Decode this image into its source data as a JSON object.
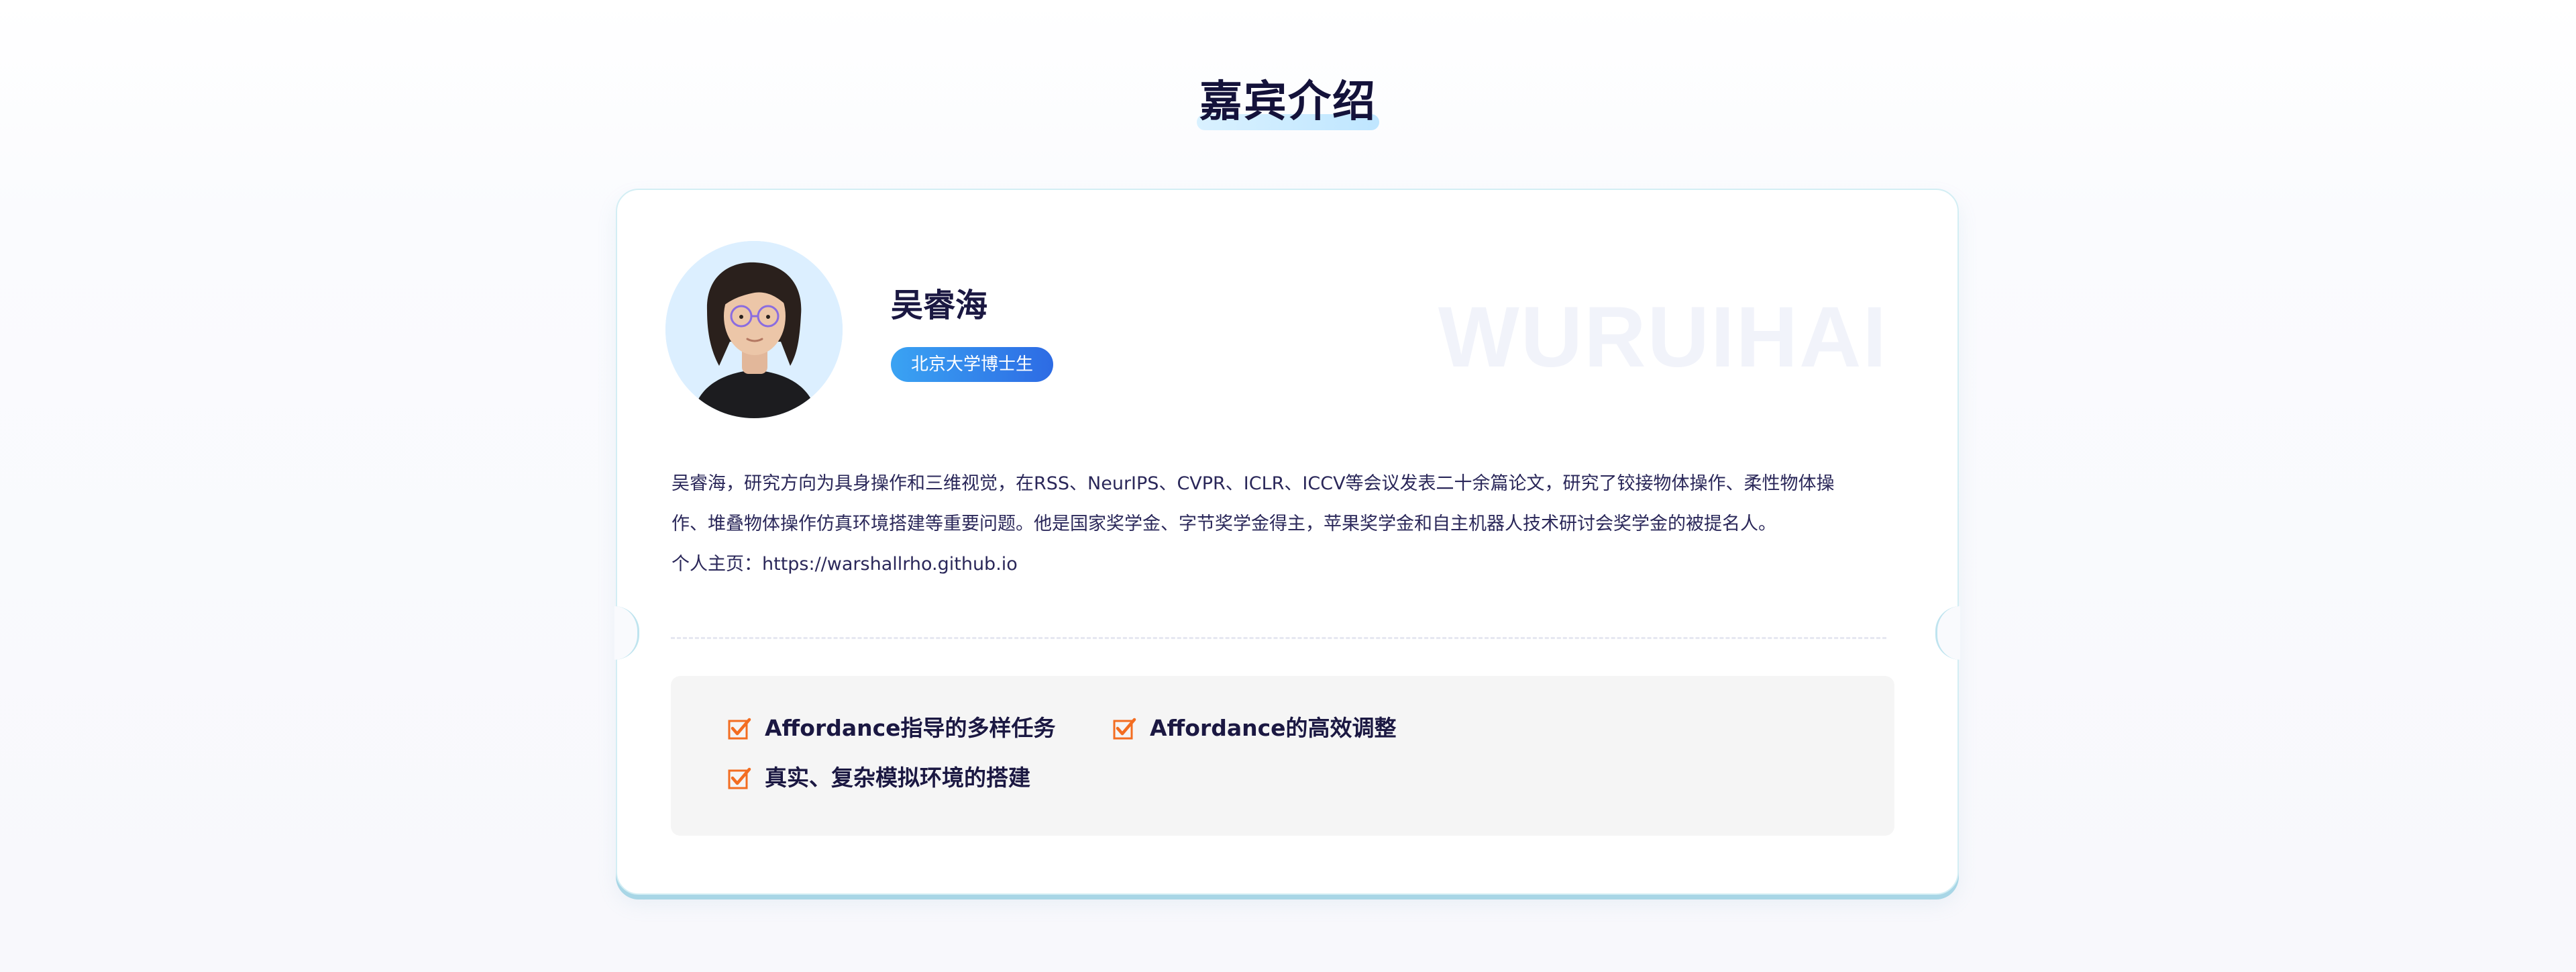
{
  "section": {
    "title": "嘉宾介绍"
  },
  "speaker": {
    "name": "吴睿海",
    "badge": "北京大学博士生",
    "watermark": "WURUIHAI",
    "bio_line1": "吴睿海，研究方向为具身操作和三维视觉，在RSS、NeurIPS、CVPR、ICLR、ICCV等会议发表二十余篇论文，研究了铰接物体操作、柔性物体操",
    "bio_line2": "作、堆叠物体操作仿真环境搭建等重要问题。他是国家奖学金、字节奖学金得主，苹果奖学金和自主机器人技术研讨会奖学金的被提名人。",
    "homepage": "个人主页：https://warshallrho.github.io"
  },
  "topics": [
    {
      "label": "Affordance指导的多样任务",
      "icon": "checkbox-checked-icon"
    },
    {
      "label": "Affordance的高效调整",
      "icon": "checkbox-checked-icon"
    },
    {
      "label": "真实、复杂模拟环境的搭建",
      "icon": "checkbox-checked-icon"
    }
  ],
  "colors": {
    "accent": "#2d6be4",
    "check": "#f36d21",
    "title": "#14123a",
    "card_border": "#d3eef4"
  }
}
